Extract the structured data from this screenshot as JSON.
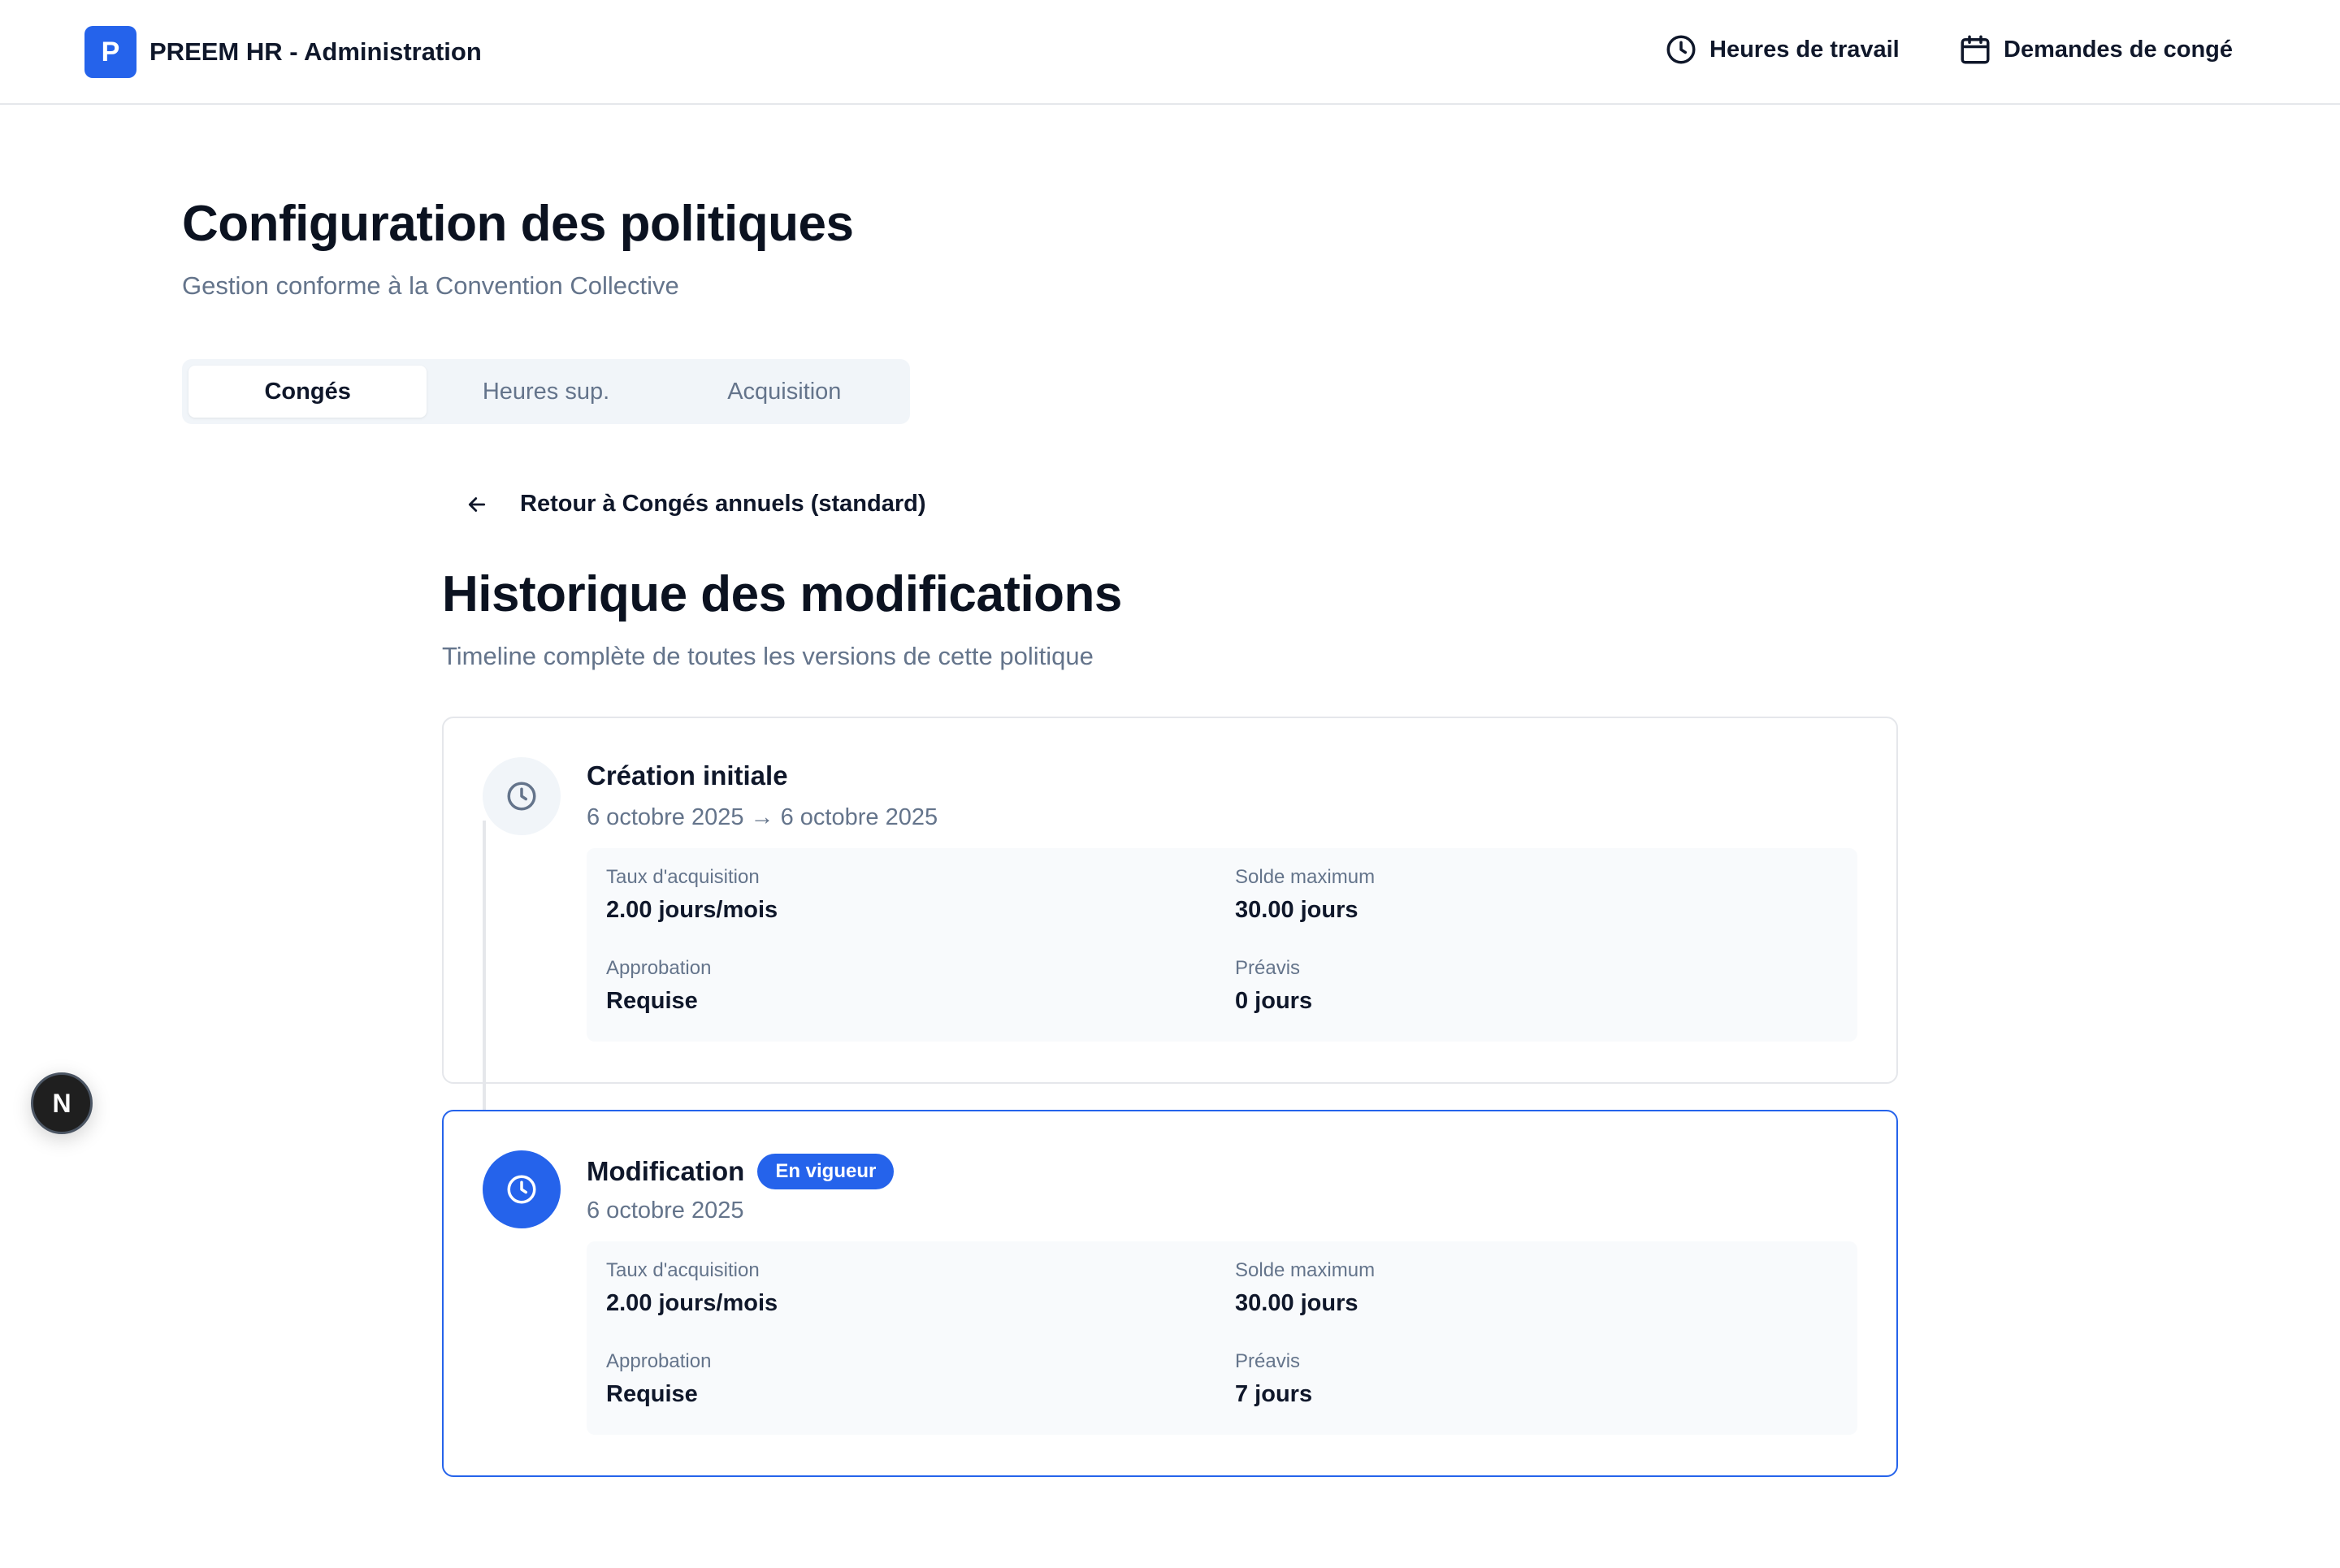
{
  "header": {
    "logo_letter": "P",
    "title": "PREEM HR - Administration",
    "nav": [
      {
        "label": "Heures de travail",
        "icon": "clock-icon"
      },
      {
        "label": "Demandes de congé",
        "icon": "calendar-icon"
      }
    ]
  },
  "page": {
    "title": "Configuration des politiques",
    "subtitle": "Gestion conforme à la Convention Collective"
  },
  "tabs": [
    {
      "label": "Congés",
      "active": true
    },
    {
      "label": "Heures sup.",
      "active": false
    },
    {
      "label": "Acquisition",
      "active": false
    }
  ],
  "back_link": {
    "label": "Retour à Congés annuels (standard)",
    "icon": "arrow-left-icon"
  },
  "history": {
    "title": "Historique des modifications",
    "subtitle": "Timeline complète de toutes les versions de cette politique",
    "entries": [
      {
        "title": "Création initiale",
        "dates": "6 octobre 2025 → 6 octobre 2025",
        "badge": "",
        "fields": [
          {
            "label": "Taux d'acquisition",
            "value": "2.00 jours/mois"
          },
          {
            "label": "Solde maximum",
            "value": "30.00 jours"
          },
          {
            "label": "Approbation",
            "value": "Requise"
          },
          {
            "label": "Préavis",
            "value": "0 jours"
          }
        ]
      },
      {
        "title": "Modification",
        "dates": "6 octobre 2025",
        "badge": "En vigueur",
        "fields": [
          {
            "label": "Taux d'acquisition",
            "value": "2.00 jours/mois"
          },
          {
            "label": "Solde maximum",
            "value": "30.00 jours"
          },
          {
            "label": "Approbation",
            "value": "Requise"
          },
          {
            "label": "Préavis",
            "value": "7 jours"
          }
        ]
      }
    ]
  },
  "fab": {
    "label": "N"
  },
  "colors": {
    "accent": "#2563eb",
    "muted_text": "#64748b",
    "border": "#e5e7eb"
  }
}
